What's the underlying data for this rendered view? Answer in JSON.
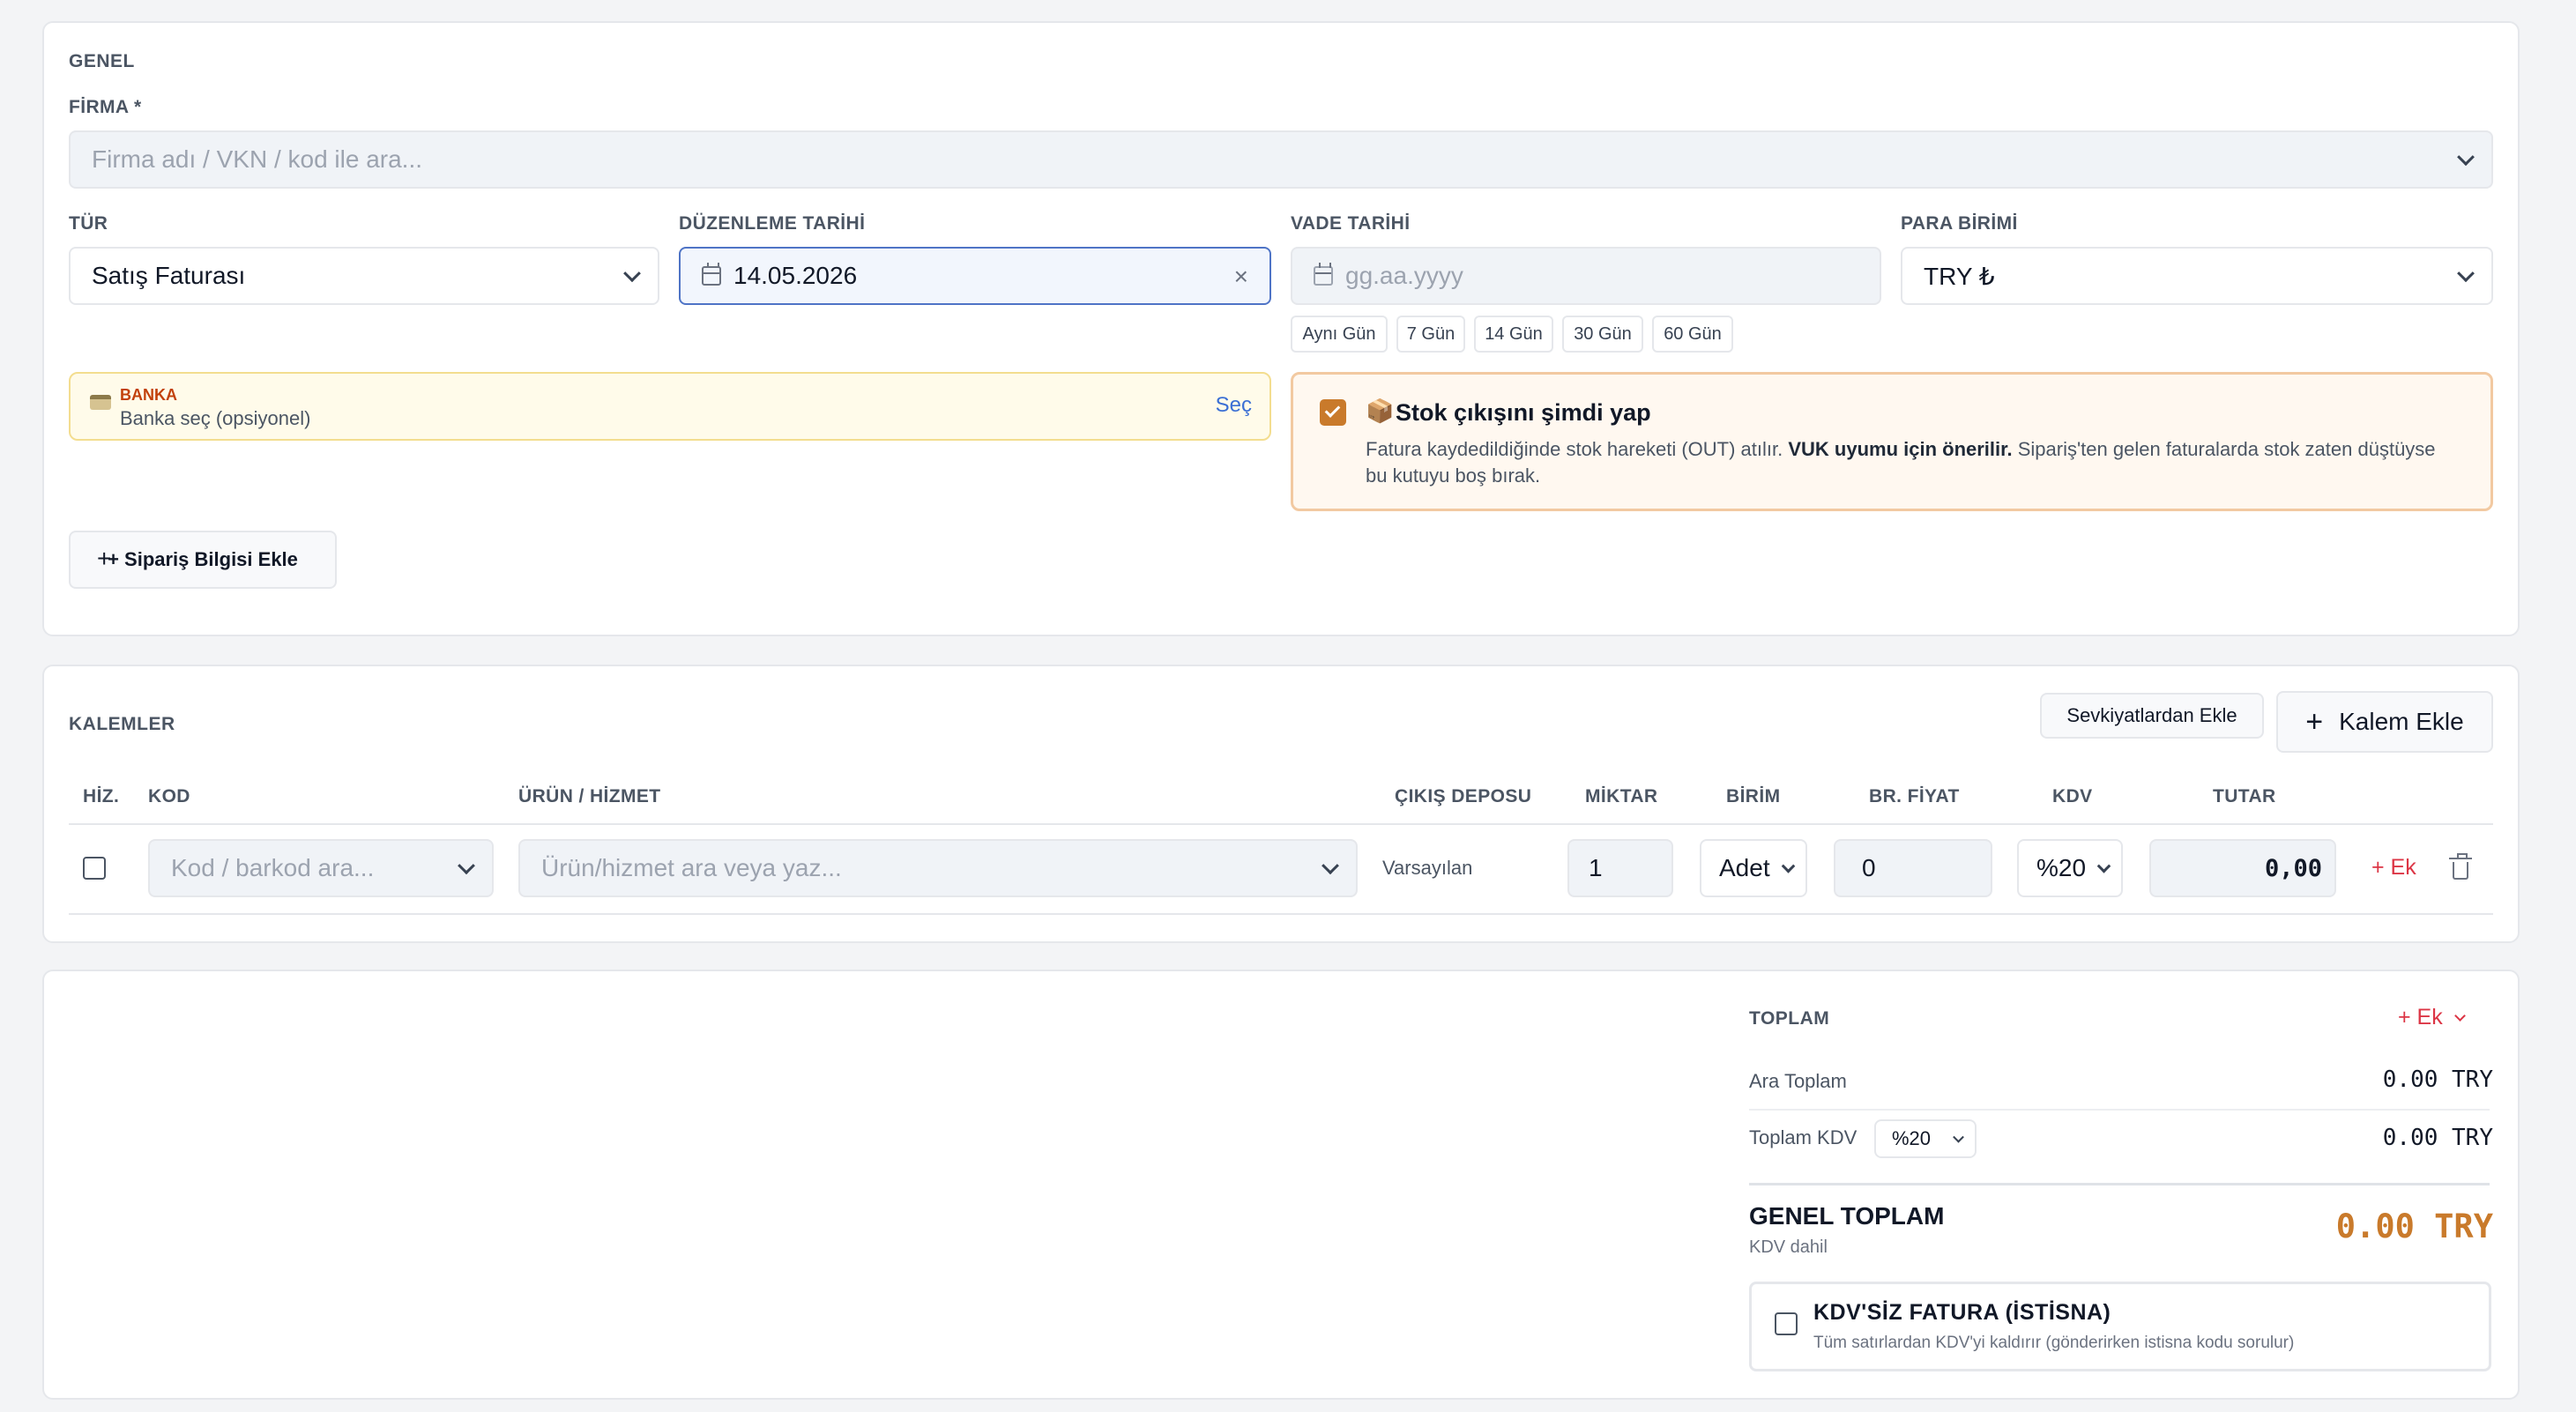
{
  "genel": {
    "section_title": "GENEL",
    "firma_label": "FİRMA *",
    "firma_placeholder": "Firma adı / VKN / kod ile ara...",
    "tur_label": "TÜR",
    "tur_value": "Satış Faturası",
    "duzenleme_label": "DÜZENLEME TARİHİ",
    "duzenleme_value": "14.05.2026",
    "vade_label": "VADE TARİHİ",
    "vade_placeholder": "gg.aa.yyyy",
    "para_label": "PARA BİRİMİ",
    "para_value": "TRY ₺",
    "vade_chips": [
      "Aynı Gün",
      "7 Gün",
      "14 Gün",
      "30 Gün",
      "60 Gün"
    ],
    "bank": {
      "title": "BANKA",
      "subtitle": "Banka seç (opsiyonel)",
      "action": "Seç",
      "icon": "credit-card-icon"
    },
    "stock": {
      "checked": true,
      "icon": "📦",
      "title": "Stok çıkışını şimdi yap",
      "desc_before": "Fatura kaydedildiğinde stok hareketi (OUT) atılır. ",
      "desc_bold": "VUK uyumu için önerilir.",
      "desc_after": " Sipariş'ten gelen faturalarda stok zaten düştüyse bu kutuyu boş bırak."
    },
    "siparis_button": "+ Sipariş Bilgisi Ekle"
  },
  "kalemler": {
    "section_title": "KALEMLER",
    "sevkiyat_button": "Sevkiyatlardan Ekle",
    "kalem_button": "Kalem Ekle",
    "columns": [
      "HİZ.",
      "KOD",
      "ÜRÜN / HİZMET",
      "ÇIKIŞ DEPOSU",
      "MİKTAR",
      "BİRİM",
      "BR. FİYAT",
      "KDV",
      "TUTAR"
    ],
    "row": {
      "kod_placeholder": "Kod / barkod ara...",
      "urun_placeholder": "Ürün/hizmet ara veya yaz...",
      "depo": "Varsayılan",
      "miktar": "1",
      "birim": "Adet",
      "fiyat": "0",
      "kdv": "%20",
      "tutar": "0,00",
      "ek_label": "+ Ek"
    }
  },
  "toplam": {
    "title": "TOPLAM",
    "ek_label": "+ Ek",
    "ara_toplam_label": "Ara Toplam",
    "ara_toplam_value": "0.00 TRY",
    "kdv_label": "Toplam KDV",
    "kdv_select": "%20",
    "kdv_value": "0.00 TRY",
    "genel_label": "GENEL TOPLAM",
    "genel_sub": "KDV dahil",
    "genel_value": "0.00 TRY",
    "kdvsiz_title": "KDV'SİZ FATURA (İSTİSNA)",
    "kdvsiz_desc": "Tüm satırlardan KDV'yi kaldırır (gönderirken istisna kodu sorulur)"
  },
  "colors": {
    "accent_orange": "#c97a2b",
    "accent_red": "#dc3545",
    "link_blue": "#3b6fd4",
    "focus_blue": "#4f74c6"
  }
}
